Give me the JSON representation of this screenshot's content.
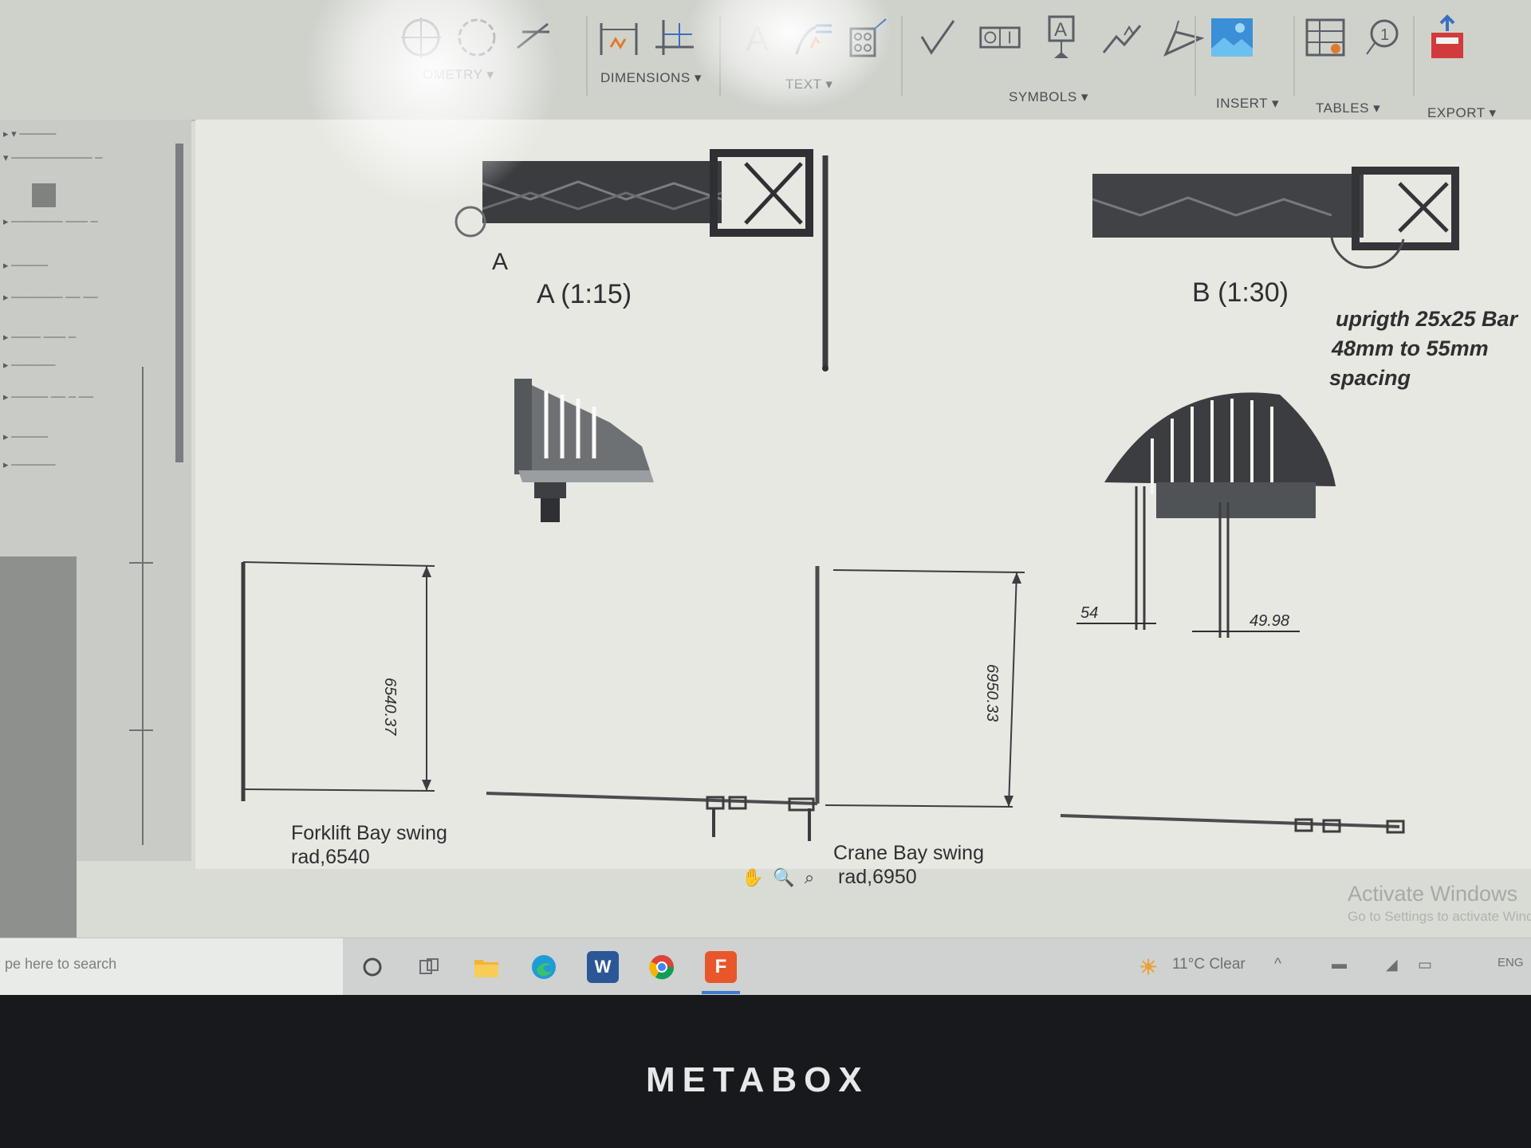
{
  "ribbon": {
    "groups": [
      {
        "label": "OMETRY ▾",
        "icon": "geometry-icon"
      },
      {
        "label": "DIMENSIONS ▾",
        "icon": "dimension-icon"
      },
      {
        "label": "TEXT ▾",
        "icon": "text-icon"
      },
      {
        "label": "SYMBOLS ▾",
        "icon": "symbol-icon"
      },
      {
        "label": "INSERT ▾",
        "icon": "insert-image-icon"
      },
      {
        "label": "TABLES ▾",
        "icon": "table-icon"
      },
      {
        "label": "EXPORT ▾",
        "icon": "export-icon"
      }
    ]
  },
  "sheet": {
    "view_a_marker": "A",
    "view_a_label": "A (1:15)",
    "view_b_label": "B (1:30)",
    "note_line1": "uprigth 25x25 Bar",
    "note_line2": "48mm to 55mm",
    "note_line3": "spacing",
    "dim_left_height": "6540.37",
    "dim_center_height": "6950.33",
    "dim_54": "54",
    "dim_4998": "49.98",
    "forklift_caption_1": "Forklift Bay swing",
    "forklift_caption_2": "rad,6540",
    "crane_caption_1": "Crane Bay swing",
    "crane_caption_2": "rad,6950"
  },
  "watermark": {
    "line1": "Activate Windows",
    "line2": "Go to Settings to activate Windows."
  },
  "navbar": {
    "pan": "✋",
    "zoom": "🔍",
    "zoom_window": "⌕"
  },
  "taskbar": {
    "search_placeholder": "pe here to search",
    "weather": "11°C  Clear",
    "tray_caret": "^",
    "lang": "ENG"
  },
  "bezel": {
    "brand": "METABOX"
  },
  "colors": {
    "sheet": "#e7e8e1",
    "ribbon": "#cfd2cb",
    "ink": "#2d2f31",
    "bezel": "#18191c"
  }
}
